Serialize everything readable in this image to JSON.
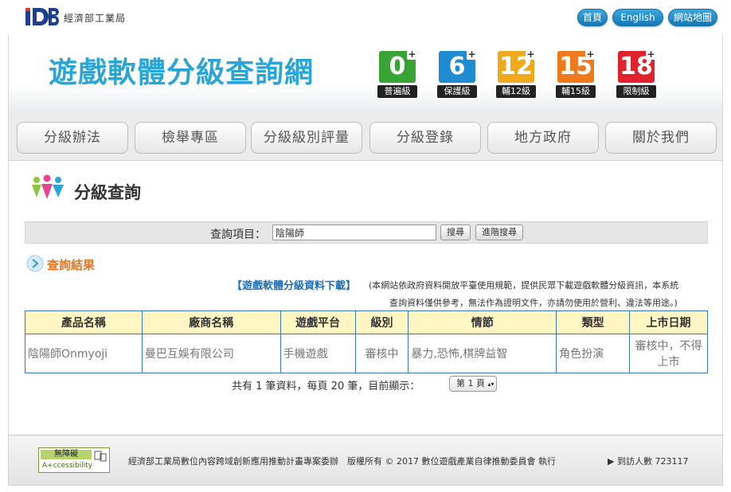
{
  "header": {
    "logo_text": "iDB",
    "ministry": "經濟部工業局",
    "buttons": [
      "首頁",
      "English",
      "網站地圖"
    ]
  },
  "banner": {
    "title": "遊戲軟體分級查詢網",
    "ratings": [
      {
        "number": "0",
        "label": "普遍級",
        "color": "#3aa335"
      },
      {
        "number": "6",
        "label": "保護級",
        "color": "#1f8bd1"
      },
      {
        "number": "12",
        "label": "輔12級",
        "color": "#f0a81c"
      },
      {
        "number": "15",
        "label": "輔15級",
        "color": "#ef7a1e"
      },
      {
        "number": "18",
        "label": "限制級",
        "color": "#e0232a"
      }
    ]
  },
  "nav": {
    "tabs": [
      "分級辦法",
      "檢舉專區",
      "分級級別評量",
      "分級登錄",
      "地方政府",
      "關於我們"
    ]
  },
  "query": {
    "title": "分級查詢",
    "search_label": "查詢項目：",
    "search_value": "陰陽師",
    "search_button": "搜尋",
    "advanced_button": "進階搜尋"
  },
  "results": {
    "title": "查詢結果",
    "download_link": "【遊戲軟體分級資料下載】",
    "notice_line1": "(本網站依政府資料開放平臺使用規範，提供民眾下載遊戲軟體分級資訊，本系統",
    "notice_line2": "查詢資料僅供參考，無法作為證明文件，亦請勿使用於營利、違法等用途。)",
    "columns": [
      "產品名稱",
      "廠商名稱",
      "遊戲平台",
      "級別",
      "情節",
      "類型",
      "上市日期"
    ],
    "rows": [
      [
        "陰陽師Onmyoji",
        "曼巴互娛有限公司",
        "手機遊戲",
        "審核中",
        "暴力,恐怖,棋牌益智",
        "角色扮演",
        "審核中，不得上市"
      ]
    ],
    "pager_text": "共有 1 筆資料，每頁 20 筆，目前顯示：",
    "page_select": "第 1 頁"
  },
  "footer": {
    "a11y_top": "無障礙",
    "a11y_bottom": "A+ccessibility",
    "text": "經濟部工業局數位內容跨域創新應用推動計畫專案委辦　版權所有 © 2017 數位遊戲產業自律推動委員會 執行",
    "visitor_label": "▶ 到訪人數",
    "visitor_count": "723117"
  }
}
